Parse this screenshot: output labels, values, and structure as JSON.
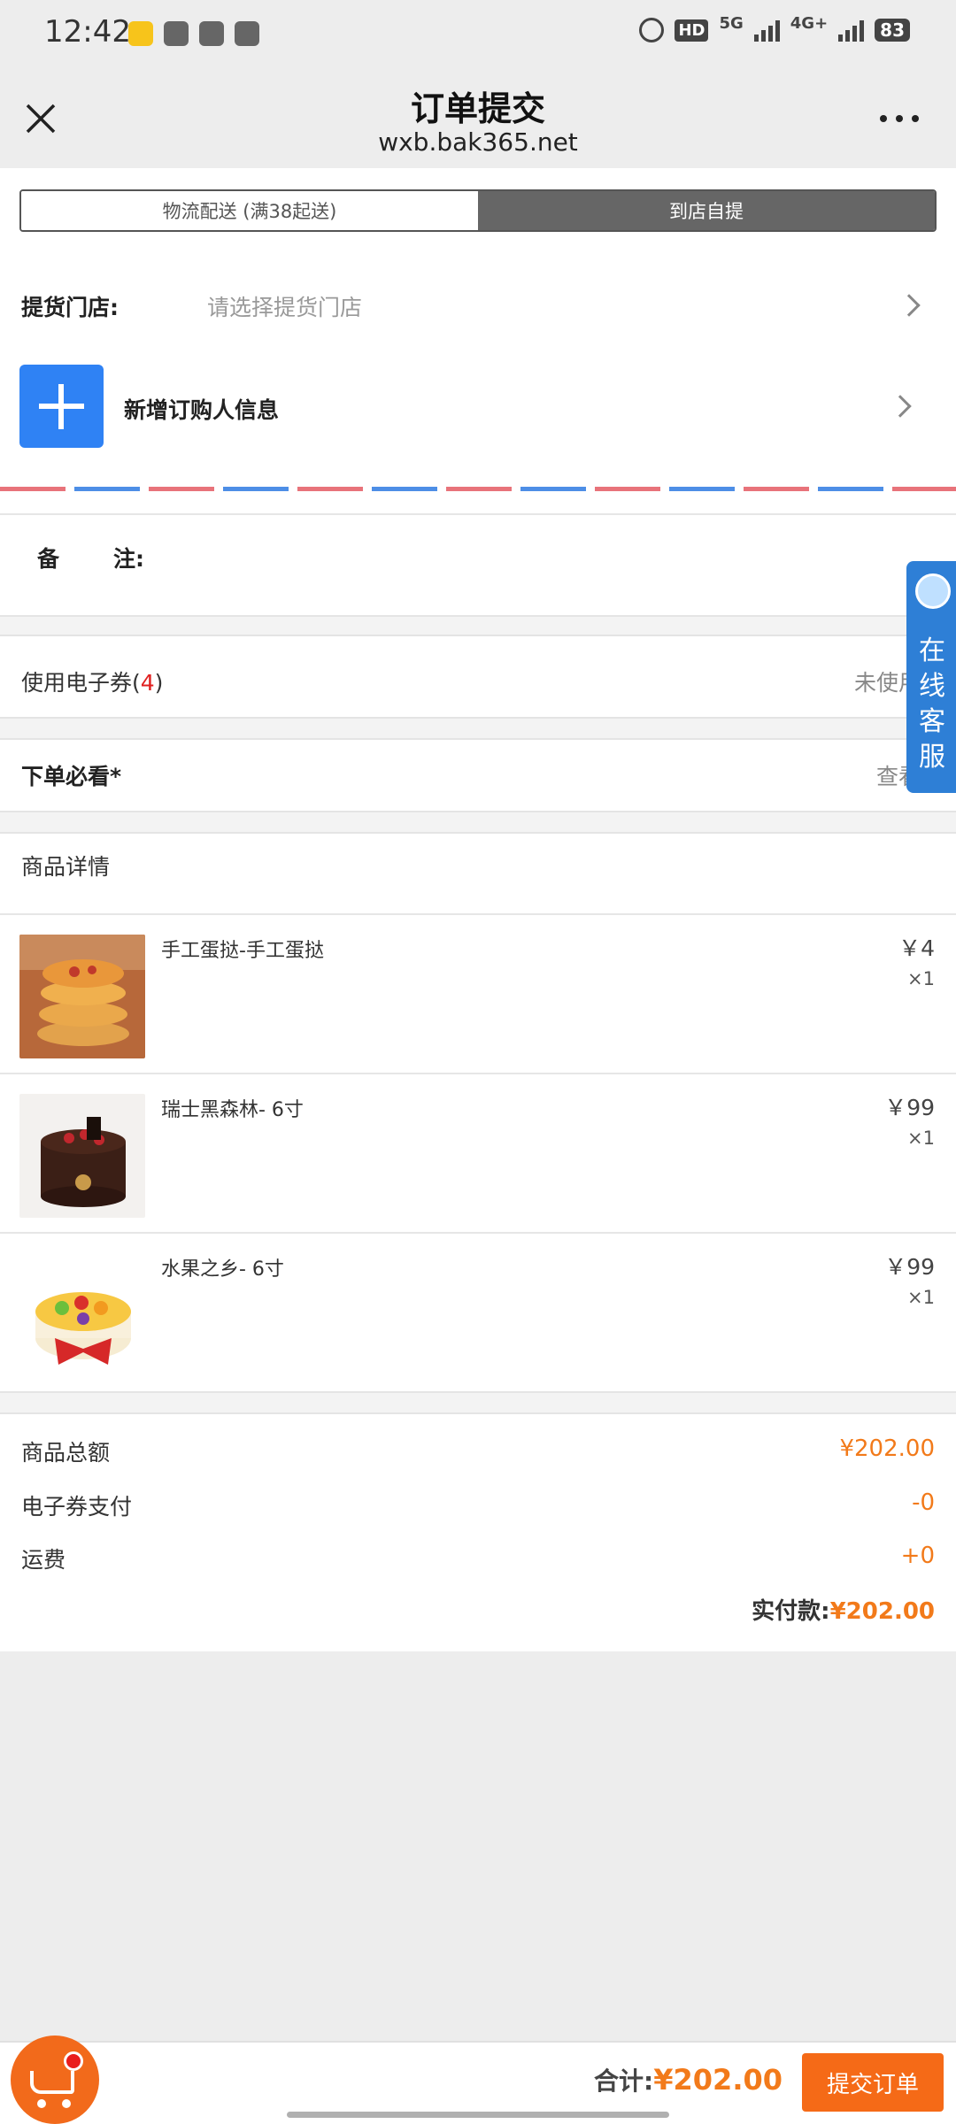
{
  "status_bar": {
    "time": "12:42",
    "hd": "HD",
    "net_5g": "5G",
    "net_4g": "4G+",
    "battery": "83"
  },
  "header": {
    "title": "订单提交",
    "subtitle": "wxb.bak365.net"
  },
  "delivery_tabs": {
    "logistics": "物流配送 (满38起送)",
    "pickup": "到店自提",
    "selected": "pickup"
  },
  "store": {
    "label": "提货门店:",
    "placeholder": "请选择提货门店"
  },
  "buyer": {
    "label": "新增订购人信息"
  },
  "remark": {
    "label_a": "备",
    "label_b": "注:"
  },
  "coupon": {
    "label": "使用电子券(",
    "count": "4",
    "label_end": ")",
    "value": "未使用"
  },
  "notice": {
    "label": "下单必看",
    "required": "*",
    "value": "查看"
  },
  "goods": {
    "heading": "商品详情",
    "items": [
      {
        "name": "手工蛋挞-手工蛋挞",
        "price": "￥4",
        "qty": "×1"
      },
      {
        "name": "瑞士黑森林- 6寸",
        "price": "￥99",
        "qty": "×1"
      },
      {
        "name": "水果之乡- 6寸",
        "price": "￥99",
        "qty": "×1"
      }
    ]
  },
  "summary": {
    "goods_total_label": "商品总额",
    "goods_total": "¥202.00",
    "coupon_pay_label": "电子券支付",
    "coupon_pay": "-0",
    "shipping_label": "运费",
    "shipping": "+0",
    "paid_label": "实付款:",
    "paid": "¥202.00"
  },
  "service": {
    "label": "在线客服"
  },
  "bottom": {
    "total_label": "合计:",
    "total": "¥202.00",
    "submit": "提交订单"
  },
  "colors": {
    "accent": "#f56a17",
    "blue": "#2f82f4"
  }
}
